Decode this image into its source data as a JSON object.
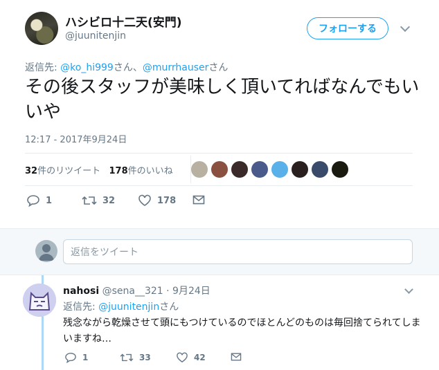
{
  "tweet": {
    "display_name": "ハシビロ十二天(安門)",
    "screen_name": "@juunitenjin",
    "follow_label": "フォローする",
    "reply_to_prefix": "返信先: ",
    "reply_to_user1": "@ko_hi999",
    "reply_to_sep": "さん、",
    "reply_to_user2": "@murrhauser",
    "reply_to_suffix": "さん",
    "text": "その後スタッフが美味しく頂いてればなんでもいいや",
    "timestamp": "12:17 - 2017年9月24日",
    "retweet_count": "32",
    "retweet_label": "件のリツイート",
    "like_count": "178",
    "like_label": "件のいいね",
    "favoriters": [
      {
        "color": "#b8b0a0"
      },
      {
        "color": "#8a5040"
      },
      {
        "color": "#3a2a2a"
      },
      {
        "color": "#4a5a8a"
      },
      {
        "color": "#5ab0e8"
      },
      {
        "color": "#2a2020"
      },
      {
        "color": "#3a4a6a"
      },
      {
        "color": "#1a1a10"
      }
    ],
    "actions": {
      "reply_count": "1",
      "retweet_count": "32",
      "like_count": "178"
    }
  },
  "reply_composer": {
    "placeholder": "返信をツイート"
  },
  "reply": {
    "display_name": "nahosi",
    "screen_name": "@sena__321",
    "date": "· 9月24日",
    "reply_to_prefix": "返信先: ",
    "reply_to_user": "@juunitenjin",
    "reply_to_suffix": "さん",
    "text": "残念ながら乾燥させて頭にもつけているのでほとんどのものは毎回捨てられてしまいますね…",
    "actions": {
      "reply_count": "1",
      "retweet_count": "33",
      "like_count": "42"
    }
  },
  "colors": {
    "accent": "#1da1f2",
    "secondary_text": "#657786",
    "thread_line": "#add8f5"
  }
}
